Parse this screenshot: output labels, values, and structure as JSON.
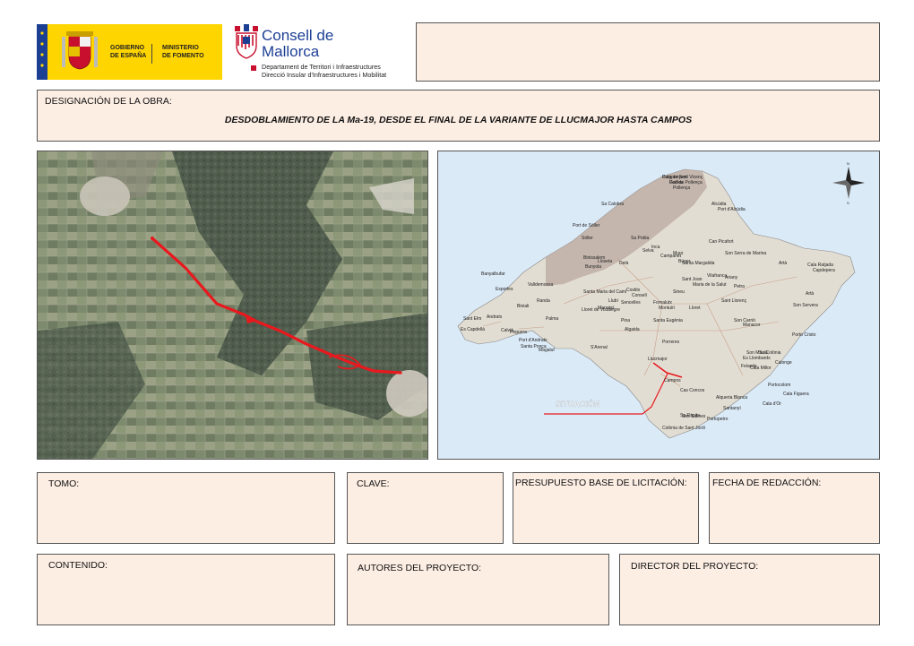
{
  "header": {
    "spain_logo": {
      "line1_left": "GOBIERNO",
      "line2_left": "DE ESPAÑA",
      "line1_right": "MINISTERIO",
      "line2_right": "DE FOMENTO"
    },
    "mallorca_logo": {
      "name_line1": "Consell de",
      "name_line2": "Mallorca",
      "dept_line1": "Departament de Territori i Infraestructures",
      "dept_line2": "Direcció Insular d'Infraestructures i Mobilitat"
    }
  },
  "work": {
    "label": "DESIGNACIÓN DE LA OBRA:",
    "title": "DESDOBLAMIENTO DE LA Ma-19, DESDE EL FINAL DE LA VARIANTE DE LLUCMAJOR HASTA CAMPOS"
  },
  "map": {
    "situation_label": "SITUACIÓN",
    "place_names": [
      "Cala de Sant Vicenç",
      "Port de Pollença",
      "Pollença",
      "Alcúdia",
      "Port d'Alcúdia",
      "Sa Calobra",
      "Port de Sóller",
      "Sóller",
      "Sa Pobla",
      "Muro",
      "Can Picafort",
      "Son Serra de Marina",
      "Inca",
      "Santa Margalida",
      "Artà",
      "Cala Ratjada",
      "Capdepera",
      "Banyalbufar",
      "Esporles",
      "Valldemossa",
      "Santa Maria del Camí",
      "Sineu",
      "Petra",
      "Manacor",
      "Porto Cristo",
      "Palma",
      "Marratxí",
      "Algaida",
      "Montuïri",
      "Porreres",
      "Felanitx",
      "Portocolom",
      "Sant Elm",
      "Andratx",
      "Calvià",
      "Peguera",
      "Santa Ponça",
      "Magaluf",
      "S'Arenal",
      "Llucmajor",
      "Campos",
      "Ses Salines",
      "Colònia de Sant Jordi",
      "Santanyí",
      "Cala d'Or",
      "Cala Millor",
      "Son Servera",
      "Artà",
      "Sa Ràpita",
      "Cas Concos",
      "Alqueria Blanca",
      "Port d'Andratx",
      "Es Capdellà",
      "Lloret de Vistalegre",
      "Sencelles",
      "Costitx",
      "Binissalem",
      "Lloseta",
      "Selva",
      "Campanet",
      "Búger",
      "Bunyola",
      "Deià",
      "Fornalutx",
      "Lloret",
      "Vilafranca",
      "Sant Llorenç",
      "Son Macià",
      "Calonge",
      "Cala Figuera",
      "Portopetro",
      "Es Llombards",
      "Sa Colònia",
      "Son Carrió",
      "Sant Joan",
      "Ariany",
      "Maria de la Salut",
      "Llubí",
      "Consell",
      "Santa Eugènia",
      "Pina",
      "Randa",
      "Biniali",
      "Puigpunyent",
      "Galilea"
    ]
  },
  "fields": {
    "tomo": "TOMO:",
    "clave": "CLAVE:",
    "presupuesto": "PRESUPUESTO BASE DE LICITACIÓN:",
    "fecha": "FECHA DE REDACCIÓN:",
    "contenido": "CONTENIDO:",
    "autores": "AUTORES DEL PROYECTO:",
    "director": "DIRECTOR DEL PROYECTO:"
  },
  "colors": {
    "box_fill": "#fdeee4",
    "route": "#e8191e",
    "border": "#555555",
    "sea": "#dbeaf7"
  }
}
